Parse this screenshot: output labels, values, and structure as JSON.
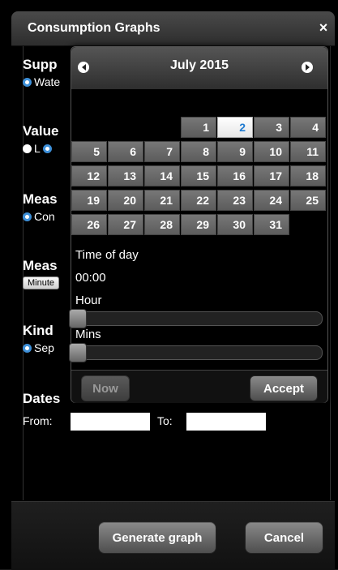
{
  "dialog": {
    "title": "Consumption Graphs",
    "close_symbol": "×"
  },
  "sections": {
    "supply": {
      "title": "Supp",
      "option": "Wate"
    },
    "value": {
      "title": "Value",
      "option_l": "L"
    },
    "measure1": {
      "title": "Meas",
      "option": "Con"
    },
    "measure2": {
      "title": "Meas",
      "button": "Minute"
    },
    "kind": {
      "title": "Kind",
      "option": "Sep"
    },
    "dates": {
      "title": "Dates",
      "from_label": "From:",
      "to_label": "To:",
      "from_value": "",
      "to_value": ""
    }
  },
  "footer": {
    "generate_label": "Generate graph",
    "cancel_label": "Cancel"
  },
  "datepicker": {
    "month_label": "July 2015",
    "selected_day": "2",
    "days": [
      "1",
      "2",
      "3",
      "4",
      "5",
      "6",
      "7",
      "8",
      "9",
      "10",
      "11",
      "12",
      "13",
      "14",
      "15",
      "16",
      "17",
      "18",
      "19",
      "20",
      "21",
      "22",
      "23",
      "24",
      "25",
      "26",
      "27",
      "28",
      "29",
      "30",
      "31"
    ],
    "time_of_day_label": "Time of day",
    "time_value": "00:00",
    "hour_label": "Hour",
    "mins_label": "Mins",
    "hour_value": 0,
    "mins_value": 0,
    "now_label": "Now",
    "accept_label": "Accept"
  },
  "colors": {
    "accent": "#3d8fd8",
    "today_text": "#1f7bd1",
    "day_cell": "#6a6a6a"
  }
}
